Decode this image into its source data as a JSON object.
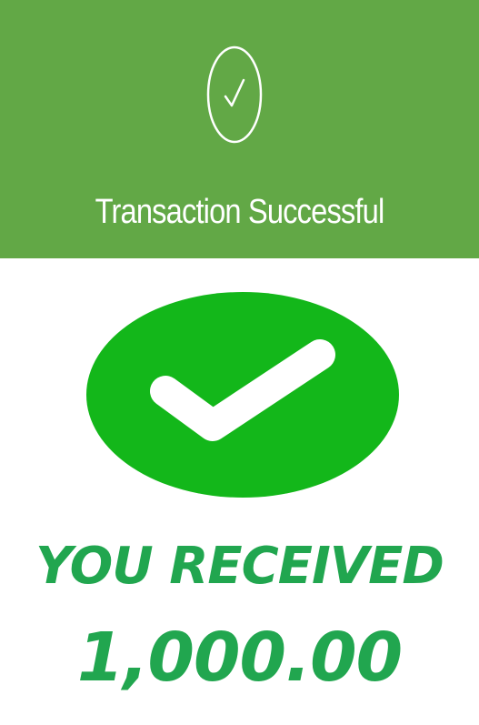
{
  "banner": {
    "title": "Transaction Successful",
    "icon": "check-circle-outline-icon",
    "background_color": "#62a846",
    "text_color": "#ffffff"
  },
  "badge": {
    "icon": "check-badge-icon",
    "color": "#13b71a"
  },
  "message": {
    "heading": "YOU RECEIVED",
    "amount": "1,000.00",
    "color": "#21a64f"
  }
}
